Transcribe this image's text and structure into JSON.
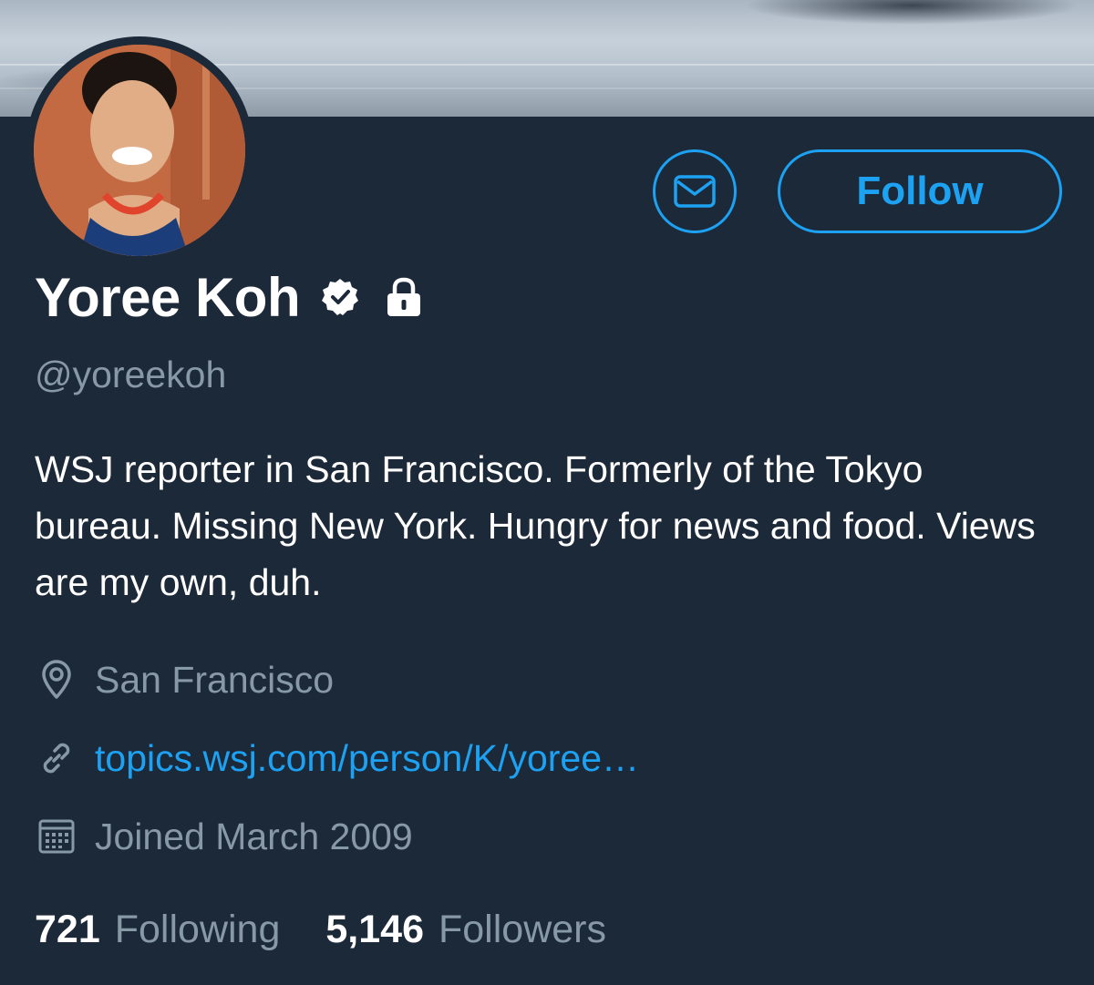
{
  "profile": {
    "name": "Yoree Koh",
    "handle": "@yoreekoh",
    "bio": "WSJ reporter in San Francisco. Formerly of the Tokyo bureau. Missing New York. Hungry for news and food. Views are my own, duh.",
    "verified": true,
    "protected": true
  },
  "actions": {
    "message_icon": "envelope-icon",
    "follow_label": "Follow"
  },
  "meta": {
    "location": "San Francisco",
    "location_icon": "location-pin-icon",
    "website": "topics.wsj.com/person/K/yoree…",
    "website_icon": "link-icon",
    "joined": "Joined March 2009",
    "joined_icon": "calendar-icon"
  },
  "stats": {
    "following_count": "721",
    "following_label": "Following",
    "followers_count": "5,146",
    "followers_label": "Followers"
  },
  "colors": {
    "background": "#1c2938",
    "accent": "#1da1f2",
    "secondary_text": "#8899a6",
    "primary_text": "#ffffff"
  }
}
